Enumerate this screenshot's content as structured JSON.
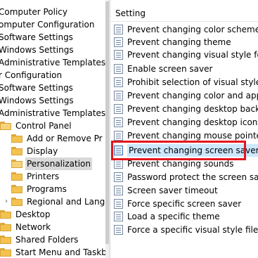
{
  "tree": {
    "items": [
      {
        "label": "Computer Policy",
        "expanded": true
      },
      {
        "label": "omputer Configuration",
        "expanded": true
      },
      {
        "label": "Software Settings",
        "expanded": false
      },
      {
        "label": "Windows Settings",
        "expanded": false
      },
      {
        "label": "Administrative Templates",
        "expanded": false
      },
      {
        "label": "r Configuration",
        "expanded": true
      },
      {
        "label": "Software Settings",
        "expanded": false
      },
      {
        "label": "Windows Settings",
        "expanded": false
      },
      {
        "label": "Administrative Templates",
        "expanded": true
      },
      {
        "label": "Control Panel",
        "expanded": true
      },
      {
        "label": "Add or Remove Pr",
        "expanded": false
      },
      {
        "label": "Display",
        "expanded": false
      },
      {
        "label": "Personalization",
        "selected": true
      },
      {
        "label": "Printers",
        "expanded": false
      },
      {
        "label": "Programs",
        "expanded": false
      },
      {
        "label": "Regional and Lang",
        "expanded": false,
        "expander": "›"
      },
      {
        "label": "Desktop",
        "expanded": false,
        "expander": "›"
      },
      {
        "label": "Network",
        "expanded": false,
        "expander": "›"
      },
      {
        "label": "Shared Folders",
        "expanded": false
      },
      {
        "label": "Start Menu and Taskba",
        "expanded": false
      }
    ]
  },
  "settings": {
    "header": "Setting",
    "items": [
      {
        "label": "Prevent changing color scheme"
      },
      {
        "label": "Prevent changing theme"
      },
      {
        "label": "Prevent changing visual style for wi"
      },
      {
        "label": "Enable screen saver"
      },
      {
        "label": "Prohibit selection of visual style fon"
      },
      {
        "label": "Prevent changing color and appear"
      },
      {
        "label": "Prevent changing desktop backgrou"
      },
      {
        "label": "Prevent changing desktop icons"
      },
      {
        "label": "Prevent changing mouse pointers"
      },
      {
        "label": "Prevent changing screen saver",
        "selected": true
      },
      {
        "label": "Prevent changing sounds"
      },
      {
        "label": "Password protect the screen saver"
      },
      {
        "label": "Screen saver timeout"
      },
      {
        "label": "Force specific screen saver"
      },
      {
        "label": "Load a specific theme"
      },
      {
        "label": "Force a specific visual style file or fo"
      }
    ]
  },
  "colors": {
    "highlight_border": "#e3161d",
    "selected_row": "#cde8ff",
    "folder": "#f3c24f"
  }
}
